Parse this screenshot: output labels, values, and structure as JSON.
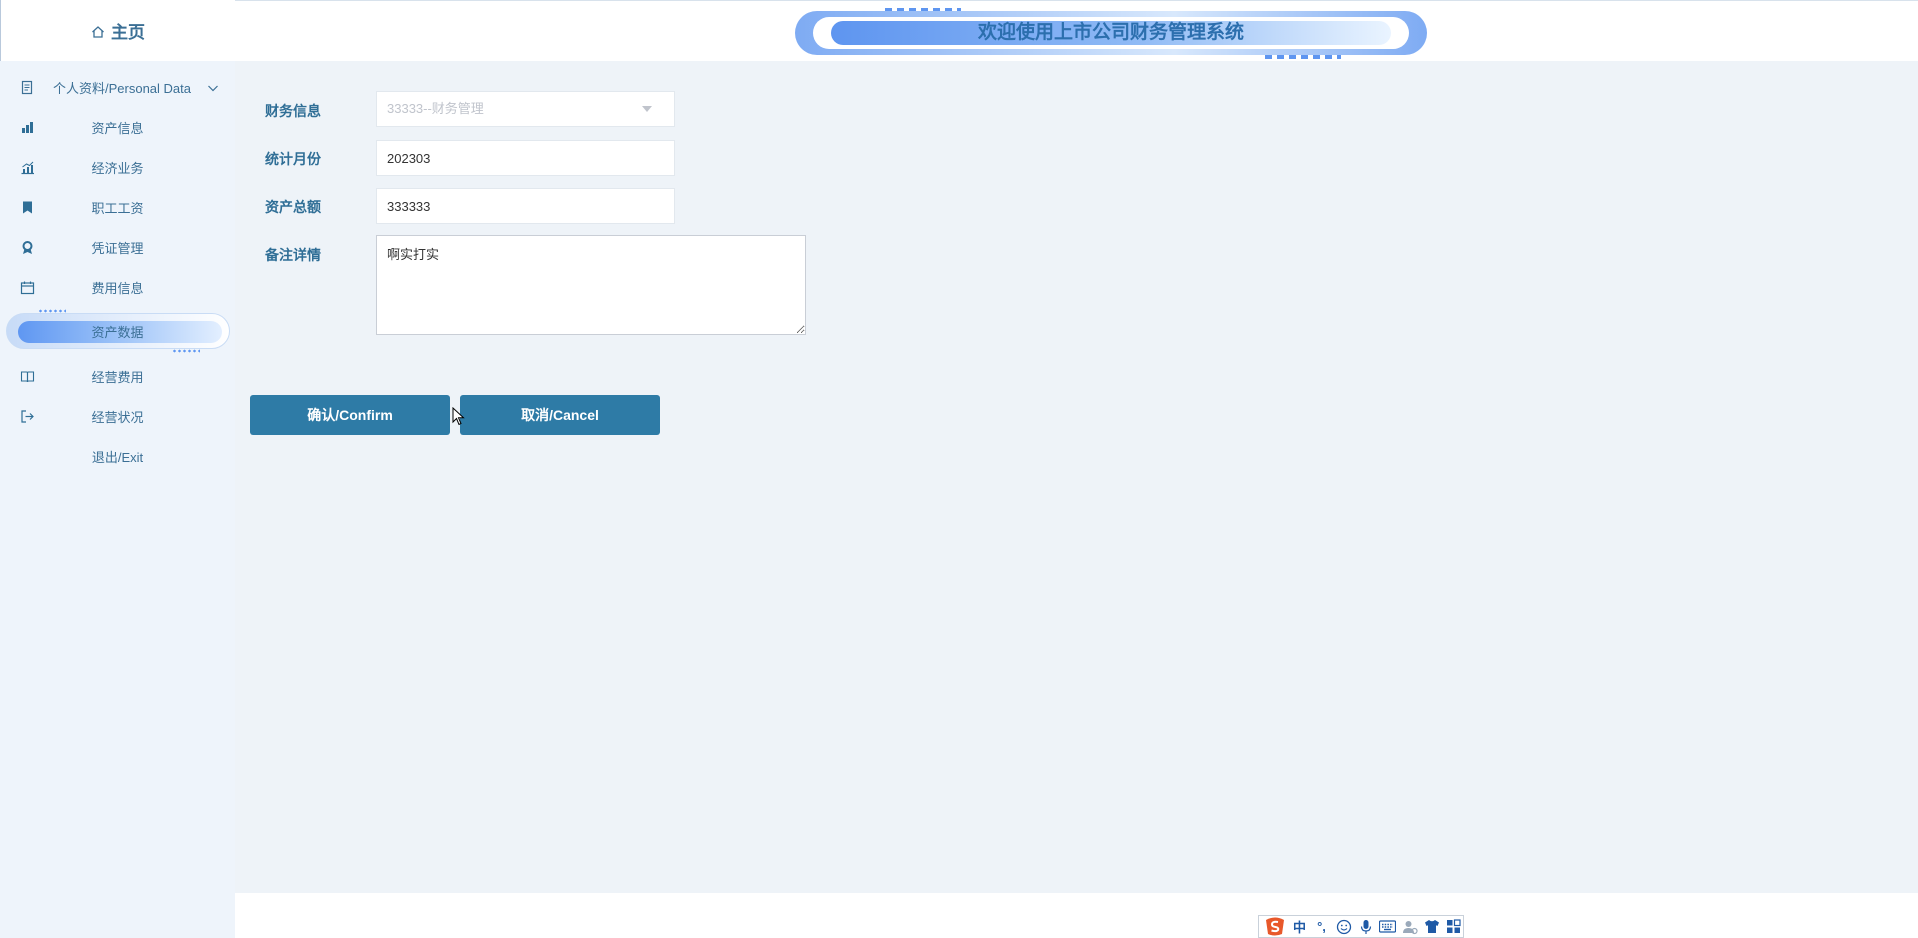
{
  "sidebar": {
    "home_label": "主页",
    "items": [
      {
        "label": "个人资料/Personal Data",
        "icon": "document-icon"
      },
      {
        "label": "资产信息",
        "icon": "building-chart-icon"
      },
      {
        "label": "经济业务",
        "icon": "bar-chart-icon"
      },
      {
        "label": "职工工资",
        "icon": "bookmark-icon"
      },
      {
        "label": "凭证管理",
        "icon": "award-icon"
      },
      {
        "label": "费用信息",
        "icon": "calendar-icon"
      },
      {
        "label": "资产数据",
        "icon": "",
        "active": true
      },
      {
        "label": "经营费用",
        "icon": "book-icon"
      },
      {
        "label": "经营状况",
        "icon": "logout-icon"
      },
      {
        "label": "退出/Exit",
        "icon": ""
      }
    ]
  },
  "header": {
    "title": "欢迎使用上市公司财务管理系统"
  },
  "form": {
    "finance_label": "财务信息",
    "finance_value": "33333--财务管理",
    "month_label": "统计月份",
    "month_value": "202303",
    "total_label": "资产总额",
    "total_value": "333333",
    "notes_label": "备注详情",
    "notes_value": "啊实打实"
  },
  "buttons": {
    "confirm": "确认/Confirm",
    "cancel": "取消/Cancel"
  },
  "ime": {
    "mode": "中",
    "punct": "°,"
  },
  "colors": {
    "accent": "#2e7ba6",
    "sidebar_bg": "#eef4fb",
    "main_bg": "#eef3f8",
    "label": "#2f6e96"
  }
}
